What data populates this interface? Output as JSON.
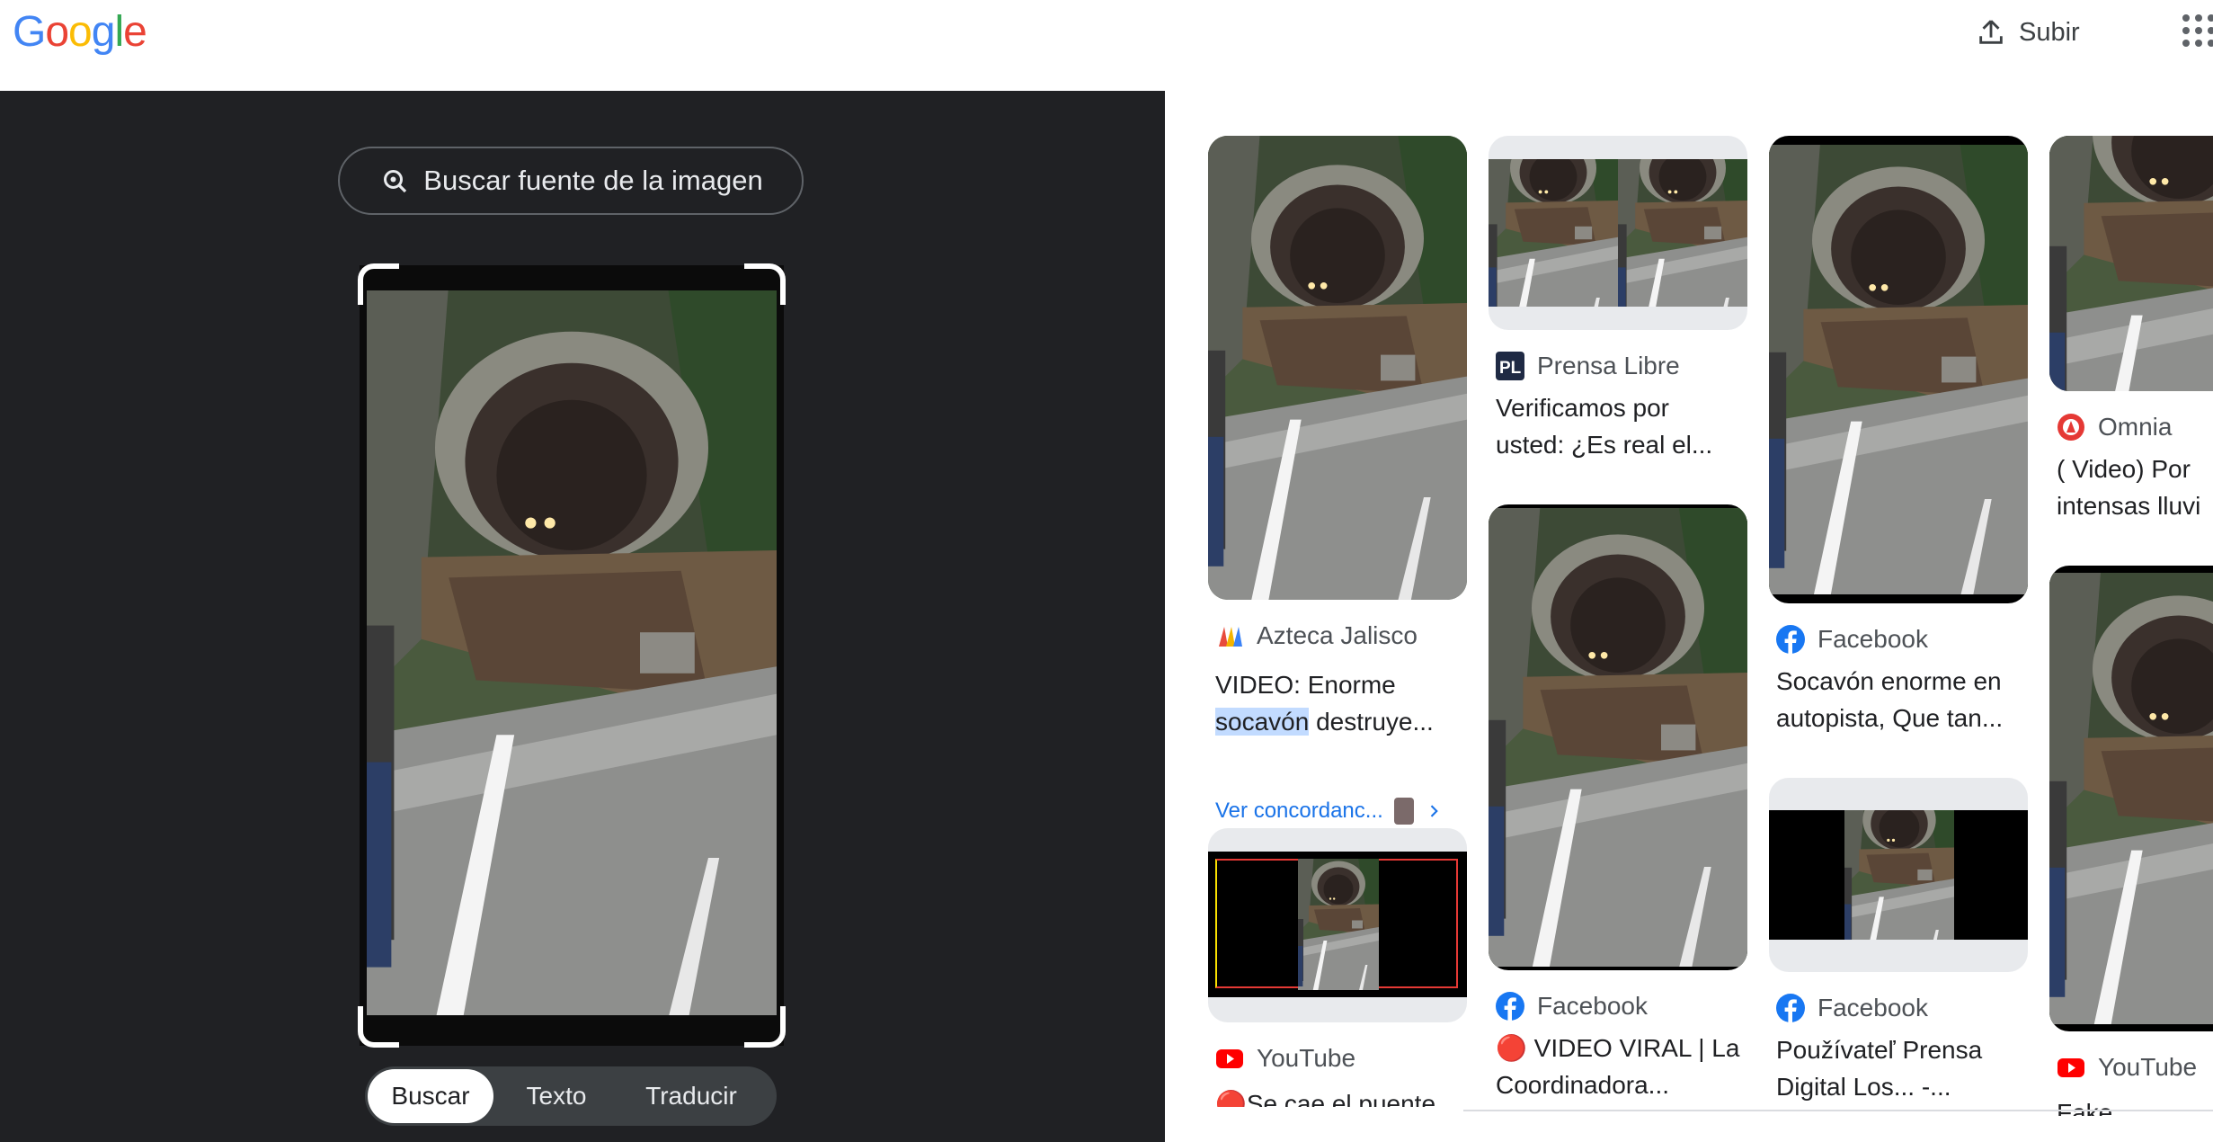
{
  "header": {
    "logo": "Google",
    "upload_label": "Subir",
    "icons": [
      "upload-icon",
      "apps-grid-icon"
    ]
  },
  "lens": {
    "find_source_label": "Buscar fuente de la imagen",
    "modes": [
      "Buscar",
      "Texto",
      "Traducir"
    ],
    "active_mode": "Buscar"
  },
  "results": [
    {
      "source": "Azteca Jalisco",
      "title_line1": "VIDEO: Enorme",
      "title_line2_hl": "socavón",
      "title_line2_rest": " destruye...",
      "match_label": "Ver concordanc..."
    },
    {
      "source": "YouTube",
      "title_line1": "🔴Se cae el puente"
    },
    {
      "source": "Prensa Libre",
      "title_line1": "Verificamos por",
      "title_line2": "usted: ¿Es real el..."
    },
    {
      "source": "Facebook",
      "title_line1": "🔴 VIDEO VIRAL | La",
      "title_line2": "Coordinadora..."
    },
    {
      "source": "Facebook",
      "title_line1": "Socavón enorme en",
      "title_line2": "autopista, Que tan..."
    },
    {
      "source": "Facebook",
      "title_line1": "Používateľ Prensa",
      "title_line2": "Digital Los... -..."
    },
    {
      "source": "Omnia",
      "title_line1": "( Video) Por",
      "title_line2": "intensas lluvi"
    },
    {
      "source": "YouTube",
      "title_line1": "Fake"
    }
  ],
  "colors": {
    "dark_bg": "#202124",
    "link": "#1a73e8",
    "highlight": "#c2dbff"
  }
}
